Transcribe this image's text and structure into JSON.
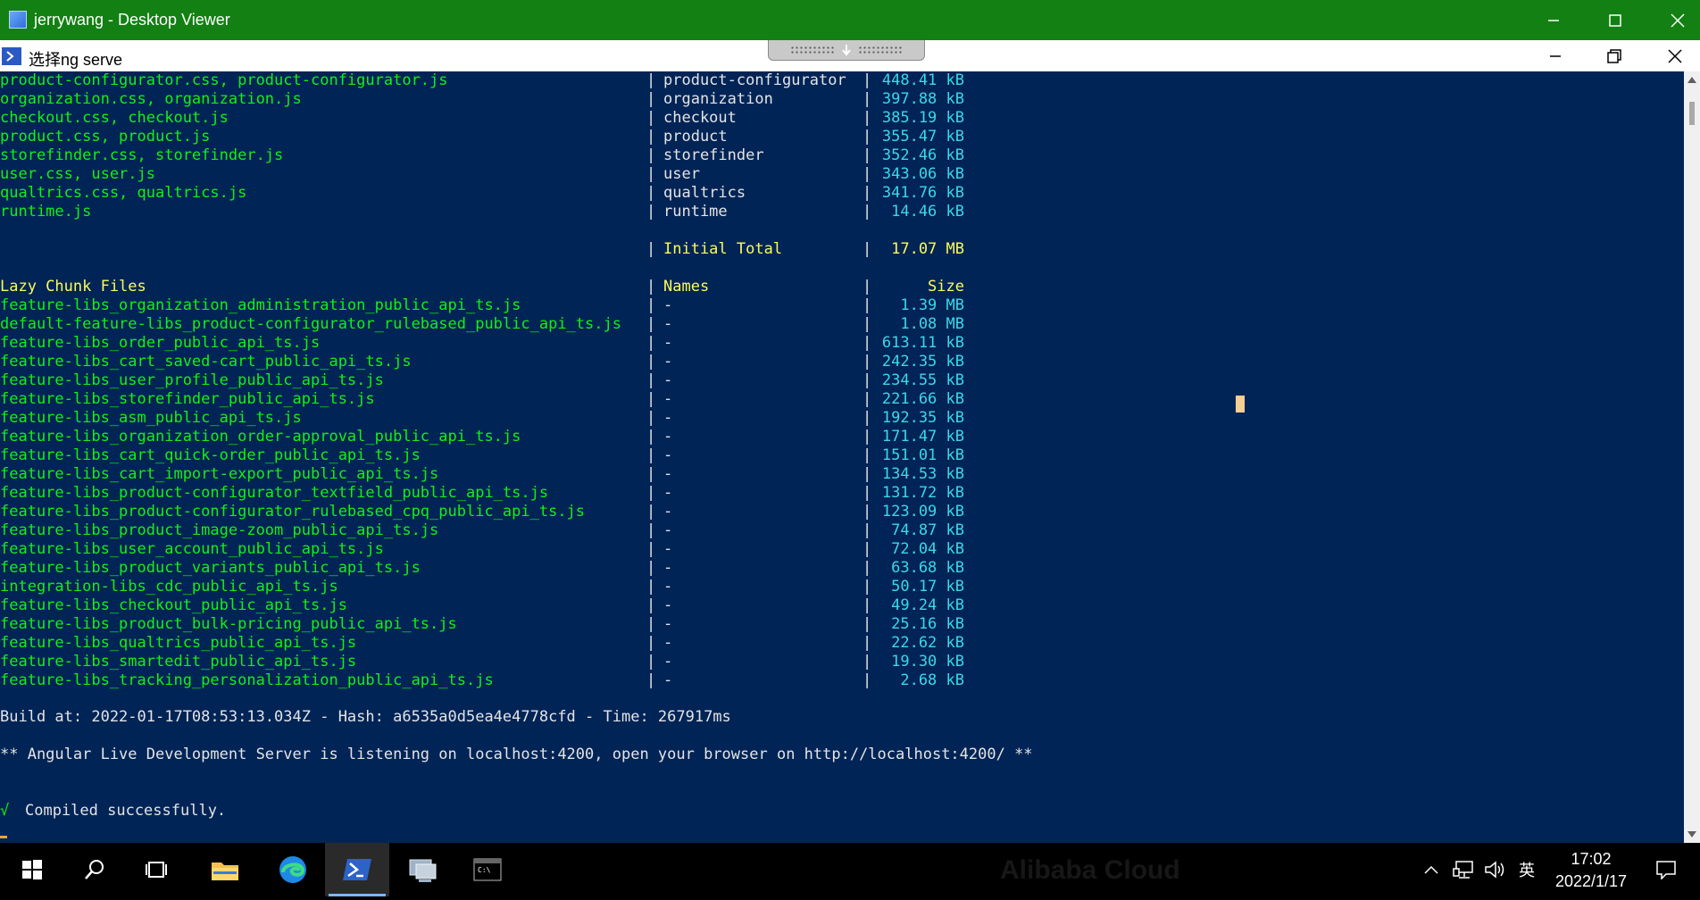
{
  "viewer": {
    "title": "jerrywang - Desktop Viewer"
  },
  "powershell": {
    "title": "选择ng serve"
  },
  "initial_rows": [
    {
      "file": "product-configurator.css, product-configurator.js",
      "name": "product-configurator",
      "size": "448.41 kB"
    },
    {
      "file": "organization.css, organization.js",
      "name": "organization",
      "size": "397.88 kB"
    },
    {
      "file": "checkout.css, checkout.js",
      "name": "checkout",
      "size": "385.19 kB"
    },
    {
      "file": "product.css, product.js",
      "name": "product",
      "size": "355.47 kB"
    },
    {
      "file": "storefinder.css, storefinder.js",
      "name": "storefinder",
      "size": "352.46 kB"
    },
    {
      "file": "user.css, user.js",
      "name": "user",
      "size": "343.06 kB"
    },
    {
      "file": "qualtrics.css, qualtrics.js",
      "name": "qualtrics",
      "size": "341.76 kB"
    },
    {
      "file": "runtime.js",
      "name": "runtime",
      "size": "14.46 kB"
    }
  ],
  "initial_total": {
    "label": "Initial Total",
    "size": "17.07 MB"
  },
  "lazy_header": {
    "files": "Lazy Chunk Files",
    "names": "Names",
    "size": "Size"
  },
  "lazy_rows": [
    {
      "file": "feature-libs_organization_administration_public_api_ts.js",
      "name": "-",
      "size": "1.39 MB"
    },
    {
      "file": "default-feature-libs_product-configurator_rulebased_public_api_ts.js",
      "name": "-",
      "size": "1.08 MB"
    },
    {
      "file": "feature-libs_order_public_api_ts.js",
      "name": "-",
      "size": "613.11 kB"
    },
    {
      "file": "feature-libs_cart_saved-cart_public_api_ts.js",
      "name": "-",
      "size": "242.35 kB"
    },
    {
      "file": "feature-libs_user_profile_public_api_ts.js",
      "name": "-",
      "size": "234.55 kB"
    },
    {
      "file": "feature-libs_storefinder_public_api_ts.js",
      "name": "-",
      "size": "221.66 kB"
    },
    {
      "file": "feature-libs_asm_public_api_ts.js",
      "name": "-",
      "size": "192.35 kB"
    },
    {
      "file": "feature-libs_organization_order-approval_public_api_ts.js",
      "name": "-",
      "size": "171.47 kB"
    },
    {
      "file": "feature-libs_cart_quick-order_public_api_ts.js",
      "name": "-",
      "size": "151.01 kB"
    },
    {
      "file": "feature-libs_cart_import-export_public_api_ts.js",
      "name": "-",
      "size": "134.53 kB"
    },
    {
      "file": "feature-libs_product-configurator_textfield_public_api_ts.js",
      "name": "-",
      "size": "131.72 kB"
    },
    {
      "file": "feature-libs_product-configurator_rulebased_cpq_public_api_ts.js",
      "name": "-",
      "size": "123.09 kB"
    },
    {
      "file": "feature-libs_product_image-zoom_public_api_ts.js",
      "name": "-",
      "size": "74.87 kB"
    },
    {
      "file": "feature-libs_user_account_public_api_ts.js",
      "name": "-",
      "size": "72.04 kB"
    },
    {
      "file": "feature-libs_product_variants_public_api_ts.js",
      "name": "-",
      "size": "63.68 kB"
    },
    {
      "file": "integration-libs_cdc_public_api_ts.js",
      "name": "-",
      "size": "50.17 kB"
    },
    {
      "file": "feature-libs_checkout_public_api_ts.js",
      "name": "-",
      "size": "49.24 kB"
    },
    {
      "file": "feature-libs_product_bulk-pricing_public_api_ts.js",
      "name": "-",
      "size": "25.16 kB"
    },
    {
      "file": "feature-libs_qualtrics_public_api_ts.js",
      "name": "-",
      "size": "22.62 kB"
    },
    {
      "file": "feature-libs_smartedit_public_api_ts.js",
      "name": "-",
      "size": "19.30 kB"
    },
    {
      "file": "feature-libs_tracking_personalization_public_api_ts.js",
      "name": "-",
      "size": "2.68 kB"
    }
  ],
  "build_line": "Build at: 2022-01-17T08:53:13.034Z - Hash: a6535a0d5ea4e4778cfd - Time: 267917ms",
  "server_line": "** Angular Live Development Server is listening on localhost:4200, open your browser on http://localhost:4200/ **",
  "compiled": {
    "check": "√",
    "text": "Compiled successfully."
  },
  "taskbar": {
    "tray_ime": "英",
    "time": "17:02",
    "date": "2022/1/17",
    "watermark": "Alibaba Cloud"
  },
  "colors": {
    "console_bg": "#012456",
    "file_green": "#13f013",
    "size_cyan": "#3bd8e8",
    "header_yellow": "#fbfb5a",
    "viewer_bar": "#128012"
  }
}
